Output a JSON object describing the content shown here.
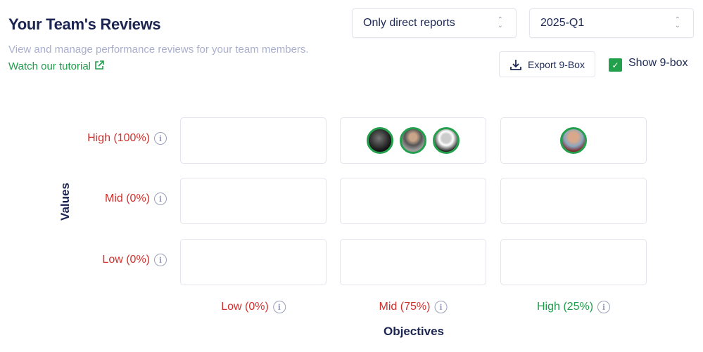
{
  "header": {
    "title": "Your Team's Reviews",
    "subtitle": "View and manage performance reviews for your team members.",
    "tutorial_link": "Watch our tutorial"
  },
  "filters": {
    "scope": "Only direct reports",
    "period": "2025-Q1"
  },
  "actions": {
    "export_label": "Export 9-Box",
    "show_label": "Show 9-box",
    "show_checked": true
  },
  "nine_box": {
    "y_axis": "Values",
    "x_axis": "Objectives",
    "rows": [
      {
        "label": "High (100%)",
        "color": "#d0312d"
      },
      {
        "label": "Mid (0%)",
        "color": "#d0312d"
      },
      {
        "label": "Low (0%)",
        "color": "#d0312d"
      }
    ],
    "cols": [
      {
        "label": "Low (0%)",
        "color": "#d0312d"
      },
      {
        "label": "Mid (75%)",
        "color": "#d0312d"
      },
      {
        "label": "High (25%)",
        "color": "#1e9e4a"
      }
    ],
    "cells": {
      "high-mid": 3,
      "high-high": 1
    }
  },
  "colors": {
    "accent": "#22a04b",
    "alert": "#d0312d"
  }
}
